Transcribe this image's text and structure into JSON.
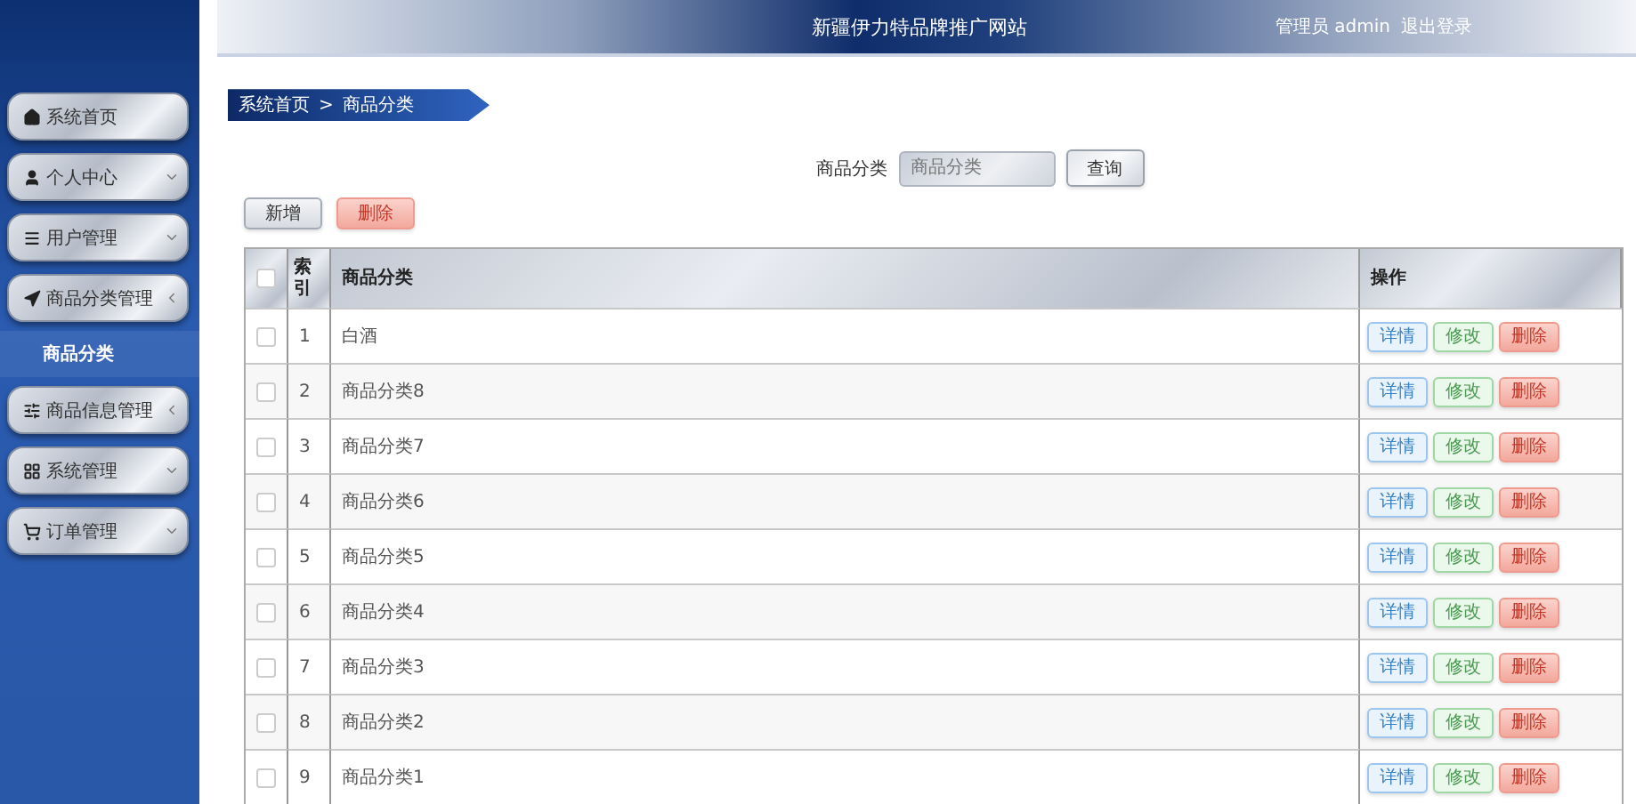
{
  "header": {
    "title": "新疆伊力特品牌推广网站",
    "user": "管理员 admin",
    "logout": "退出登录"
  },
  "sidebar": {
    "items": [
      {
        "label": "系统首页",
        "kind": "link"
      },
      {
        "label": "个人中心",
        "kind": "group",
        "expanded": false
      },
      {
        "label": "用户管理",
        "kind": "group",
        "expanded": false
      },
      {
        "label": "商品分类管理",
        "kind": "group",
        "expanded": true,
        "children": [
          {
            "label": "商品分类",
            "selected": true
          }
        ]
      },
      {
        "label": "商品信息管理",
        "kind": "group",
        "expanded": true
      },
      {
        "label": "系统管理",
        "kind": "group",
        "expanded": false
      },
      {
        "label": "订单管理",
        "kind": "group",
        "expanded": false
      }
    ]
  },
  "breadcrumb": [
    "系统首页",
    "商品分类"
  ],
  "breadcrumb_separator": ">",
  "search": {
    "label": "商品分类",
    "placeholder": "商品分类",
    "button": "查询"
  },
  "actions": [
    "新增",
    "删除"
  ],
  "table": {
    "header_checked": false,
    "columns": [
      "索引",
      "商品分类",
      "操作"
    ],
    "rows": [
      {
        "index": "1",
        "name": "白酒",
        "checked": false,
        "buttons": [
          "详情",
          "修改",
          "删除"
        ]
      },
      {
        "index": "2",
        "name": "商品分类8",
        "checked": false,
        "buttons": [
          "详情",
          "修改",
          "删除"
        ]
      },
      {
        "index": "3",
        "name": "商品分类7",
        "checked": false,
        "buttons": [
          "详情",
          "修改",
          "删除"
        ]
      },
      {
        "index": "4",
        "name": "商品分类6",
        "checked": false,
        "buttons": [
          "详情",
          "修改",
          "删除"
        ]
      },
      {
        "index": "5",
        "name": "商品分类5",
        "checked": false,
        "buttons": [
          "详情",
          "修改",
          "删除"
        ]
      },
      {
        "index": "6",
        "name": "商品分类4",
        "checked": false,
        "buttons": [
          "详情",
          "修改",
          "删除"
        ]
      },
      {
        "index": "7",
        "name": "商品分类3",
        "checked": false,
        "buttons": [
          "详情",
          "修改",
          "删除"
        ]
      },
      {
        "index": "8",
        "name": "商品分类2",
        "checked": false,
        "buttons": [
          "详情",
          "修改",
          "删除"
        ]
      },
      {
        "index": "9",
        "name": "商品分类1",
        "checked": false,
        "buttons": [
          "详情",
          "修改",
          "删除"
        ]
      }
    ]
  }
}
